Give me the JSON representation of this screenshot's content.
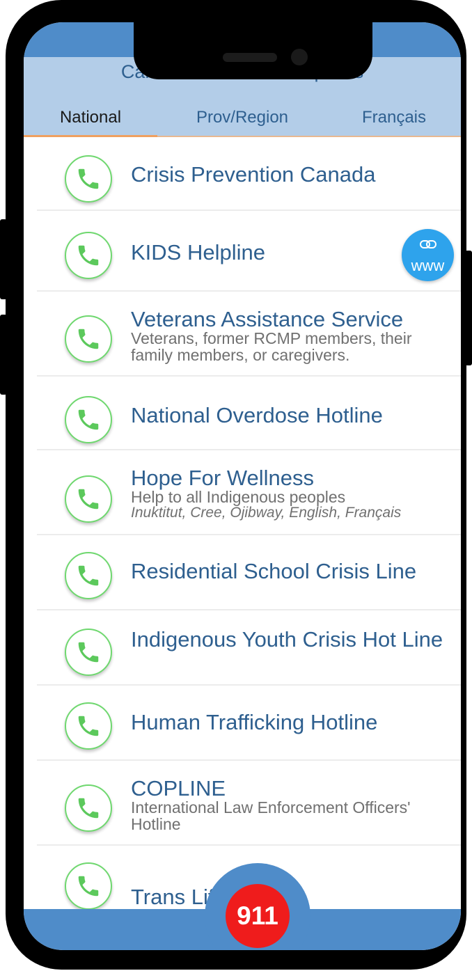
{
  "header": {
    "title": "Canada 24/7 Crisis Helplines",
    "tabs": [
      {
        "label": "National",
        "active": true
      },
      {
        "label": "Prov/Region",
        "active": false
      },
      {
        "label": "Français",
        "active": false
      }
    ]
  },
  "helplines": [
    {
      "title": "Crisis Prevention Canada",
      "icon": "phone-icon"
    },
    {
      "title": "KIDS Helpline",
      "icon": "phone-icon"
    },
    {
      "title": "Veterans Assistance Service",
      "subtitle": "Veterans, former RCMP members, their family members, or caregivers.",
      "icon": "phone-icon"
    },
    {
      "title": "National Overdose Hotline",
      "icon": "phone-icon"
    },
    {
      "title": "Hope For Wellness",
      "subtitle": "Help to all Indigenous peoples",
      "languages": "Inuktitut, Cree, Ojibway, English, Français",
      "icon": "phone-icon"
    },
    {
      "title": "Residential School Crisis Line",
      "icon": "phone-icon"
    },
    {
      "title": "Indigenous Youth Crisis Hot Line",
      "icon": "phone-icon"
    },
    {
      "title": "Human Trafficking Hotline",
      "icon": "phone-icon"
    },
    {
      "title": "COPLINE",
      "subtitle": "International Law Enforcement Officers' Hotline",
      "icon": "phone-icon"
    },
    {
      "title": "Trans Lif",
      "icon": "phone-icon"
    }
  ],
  "www_button": {
    "label": "www",
    "icon": "link-icon"
  },
  "emergency_button": {
    "label": "911"
  },
  "colors": {
    "primary": "#4f8cc9",
    "header_bg": "#b3cde8",
    "title_text": "#2e5f8f",
    "tab_indicator": "#f0a060",
    "phone_icon_green": "#5cc95c",
    "www_fab": "#2ea3ec",
    "emergency_red": "#ef1c1c"
  }
}
